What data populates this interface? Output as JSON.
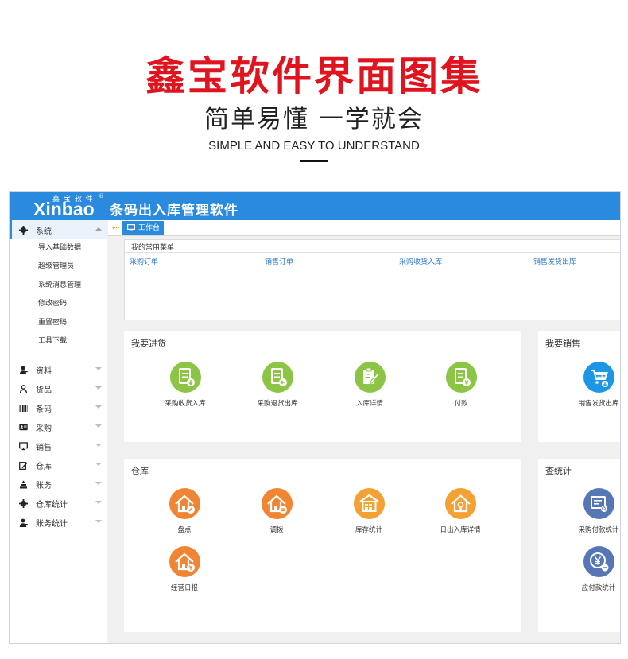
{
  "banner": {
    "title": "鑫宝软件界面图集",
    "subtitle": "简单易懂 一学就会",
    "english": "SIMPLE AND EASY TO UNDERSTAND"
  },
  "app": {
    "logo_small": "鑫 宝 软 件",
    "logo_main": "Xinbao",
    "logo_reg": "®",
    "title": "条码出入库管理软件"
  },
  "sidebar": {
    "active_group": {
      "label": "系统",
      "icon": "gear-icon"
    },
    "sub_items": [
      "导入基础数据",
      "超级管理员",
      "系统消息管理",
      "修改密码",
      "重置密码",
      "工具下载"
    ],
    "groups": [
      {
        "label": "资料",
        "icon": "user-icon"
      },
      {
        "label": "货品",
        "icon": "person-icon"
      },
      {
        "label": "条码",
        "icon": "barcode-icon"
      },
      {
        "label": "采购",
        "icon": "id-card-icon"
      },
      {
        "label": "销售",
        "icon": "monitor-icon"
      },
      {
        "label": "仓库",
        "icon": "edit-icon"
      },
      {
        "label": "账务",
        "icon": "stack-icon"
      },
      {
        "label": "仓库统计",
        "icon": "gear-icon"
      },
      {
        "label": "账务统计",
        "icon": "user-icon"
      }
    ]
  },
  "tabbar": {
    "back": "⇠",
    "active_tab": "工作台"
  },
  "favorites": {
    "title": "我的常用菜单",
    "links": [
      "采购订单",
      "销售订单",
      "采购收货入库",
      "销售发货出库"
    ]
  },
  "panels": {
    "purchase": {
      "title": "我要进货",
      "tiles": [
        {
          "label": "采购收货入库",
          "icon": "doc-download-icon"
        },
        {
          "label": "采购退货出库",
          "icon": "doc-return-icon"
        },
        {
          "label": "入库详情",
          "icon": "clipboard-edit-icon"
        },
        {
          "label": "付款",
          "icon": "doc-yen-icon"
        }
      ]
    },
    "sales": {
      "title": "我要销售",
      "tiles": [
        {
          "label": "销售发货出库",
          "icon": "cart-icon"
        }
      ]
    },
    "warehouse": {
      "title": "仓库",
      "tiles": [
        {
          "label": "盘点",
          "icon": "house-edit-icon"
        },
        {
          "label": "调拨",
          "icon": "house-transfer-icon"
        },
        {
          "label": "库存统计",
          "icon": "warehouse-icon"
        },
        {
          "label": "日出入库详情",
          "icon": "house-detail-icon"
        },
        {
          "label": "经营日报",
          "icon": "house-report-icon"
        }
      ]
    },
    "stats": {
      "title": "查统计",
      "tiles": [
        {
          "label": "采购付款统计",
          "icon": "report-search-icon"
        },
        {
          "label": "应付款统计",
          "icon": "yen-minus-icon"
        }
      ]
    }
  },
  "colors": {
    "accent": "#2a8bde",
    "title_red": "#e0141e",
    "green": "#8cc545",
    "orange": "#f08533",
    "amber": "#f2a132",
    "slate": "#5676b6"
  }
}
